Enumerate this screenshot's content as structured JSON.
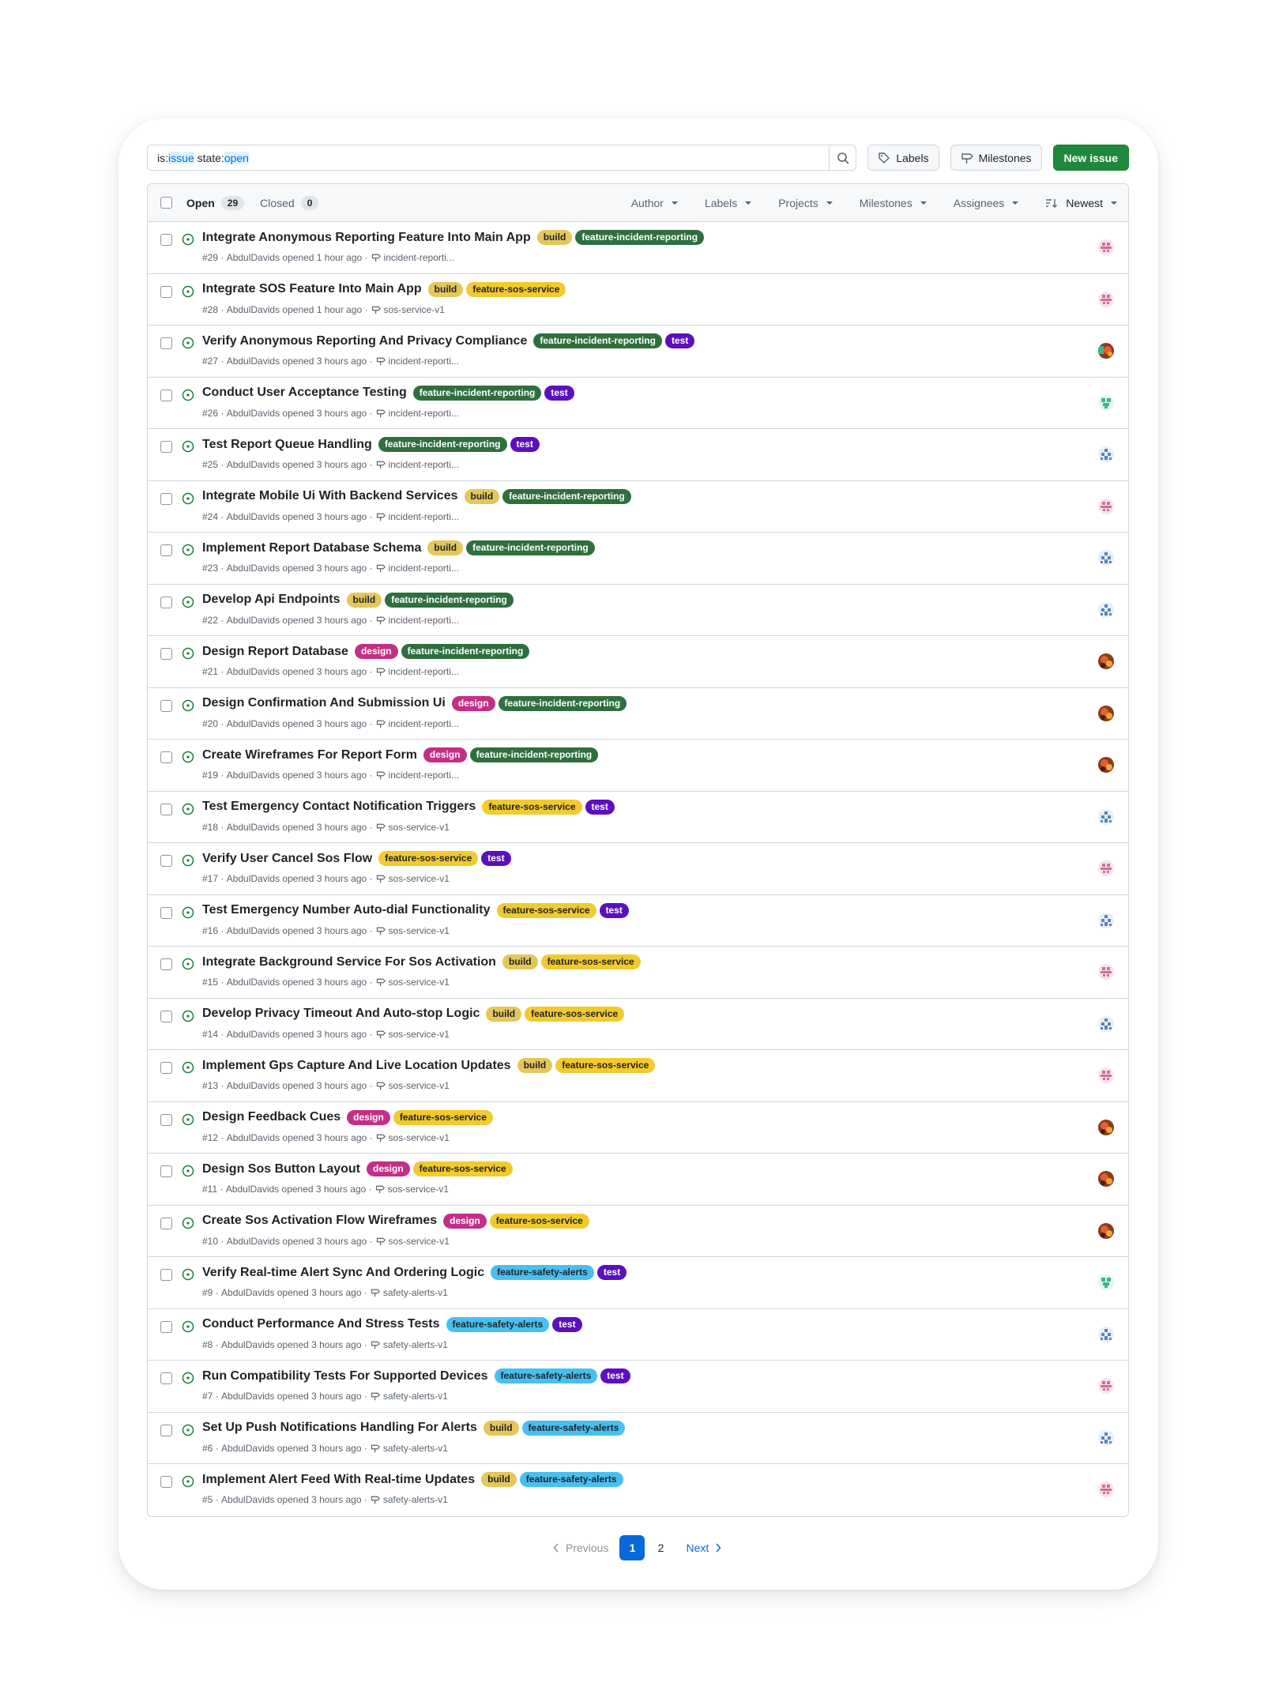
{
  "search": {
    "query_plain_1": "is:",
    "query_hl_1": "issue",
    "query_plain_2": " state:",
    "query_hl_2": "open"
  },
  "toolbar": {
    "labels": "Labels",
    "milestones": "Milestones",
    "new_issue": "New issue"
  },
  "header": {
    "open_label": "Open",
    "open_count": "29",
    "closed_label": "Closed",
    "closed_count": "0",
    "filters": {
      "author": "Author",
      "labels": "Labels",
      "projects": "Projects",
      "milestones": "Milestones",
      "assignees": "Assignees",
      "sort": "Newest"
    }
  },
  "colors": {
    "build": "#e4c65a",
    "feature-incident-reporting": "#2f6f3e",
    "feature-sos-service": "#f2ca2d",
    "test": "#5b0fbe",
    "design": "#c42f86",
    "feature-safety-alerts": "#47c0f0"
  },
  "issues": [
    {
      "title": "Integrate Anonymous Reporting Feature Into Main App",
      "labels": [
        "build",
        "feature-incident-reporting"
      ],
      "number": "#29",
      "author": "AbdulDavids",
      "time": "opened 1 hour ago",
      "milestone": "incident-reporti...",
      "avatar": "pink"
    },
    {
      "title": "Integrate SOS Feature Into Main App",
      "labels": [
        "build",
        "feature-sos-service"
      ],
      "number": "#28",
      "author": "AbdulDavids",
      "time": "opened 1 hour ago",
      "milestone": "sos-service-v1",
      "avatar": "pink"
    },
    {
      "title": "Verify Anonymous Reporting And Privacy Compliance",
      "labels": [
        "feature-incident-reporting",
        "test"
      ],
      "number": "#27",
      "author": "AbdulDavids",
      "time": "opened 3 hours ago",
      "milestone": "incident-reporti...",
      "avatar": "duo"
    },
    {
      "title": "Conduct User Acceptance Testing",
      "labels": [
        "feature-incident-reporting",
        "test"
      ],
      "number": "#26",
      "author": "AbdulDavids",
      "time": "opened 3 hours ago",
      "milestone": "incident-reporti...",
      "avatar": "green"
    },
    {
      "title": "Test Report Queue Handling",
      "labels": [
        "feature-incident-reporting",
        "test"
      ],
      "number": "#25",
      "author": "AbdulDavids",
      "time": "opened 3 hours ago",
      "milestone": "incident-reporti...",
      "avatar": "blue"
    },
    {
      "title": "Integrate Mobile Ui With Backend Services",
      "labels": [
        "build",
        "feature-incident-reporting"
      ],
      "number": "#24",
      "author": "AbdulDavids",
      "time": "opened 3 hours ago",
      "milestone": "incident-reporti...",
      "avatar": "pink"
    },
    {
      "title": "Implement Report Database Schema",
      "labels": [
        "build",
        "feature-incident-reporting"
      ],
      "number": "#23",
      "author": "AbdulDavids",
      "time": "opened 3 hours ago",
      "milestone": "incident-reporti...",
      "avatar": "blue"
    },
    {
      "title": "Develop Api Endpoints",
      "labels": [
        "build",
        "feature-incident-reporting"
      ],
      "number": "#22",
      "author": "AbdulDavids",
      "time": "opened 3 hours ago",
      "milestone": "incident-reporti...",
      "avatar": "blue"
    },
    {
      "title": "Design Report Database",
      "labels": [
        "design",
        "feature-incident-reporting"
      ],
      "number": "#21",
      "author": "AbdulDavids",
      "time": "opened 3 hours ago",
      "milestone": "incident-reporti...",
      "avatar": "photo"
    },
    {
      "title": "Design Confirmation And Submission Ui",
      "labels": [
        "design",
        "feature-incident-reporting"
      ],
      "number": "#20",
      "author": "AbdulDavids",
      "time": "opened 3 hours ago",
      "milestone": "incident-reporti...",
      "avatar": "photo"
    },
    {
      "title": "Create Wireframes For Report Form",
      "labels": [
        "design",
        "feature-incident-reporting"
      ],
      "number": "#19",
      "author": "AbdulDavids",
      "time": "opened 3 hours ago",
      "milestone": "incident-reporti...",
      "avatar": "photo"
    },
    {
      "title": "Test Emergency Contact Notification Triggers",
      "labels": [
        "feature-sos-service",
        "test"
      ],
      "number": "#18",
      "author": "AbdulDavids",
      "time": "opened 3 hours ago",
      "milestone": "sos-service-v1",
      "avatar": "blue"
    },
    {
      "title": "Verify User Cancel Sos Flow",
      "labels": [
        "feature-sos-service",
        "test"
      ],
      "number": "#17",
      "author": "AbdulDavids",
      "time": "opened 3 hours ago",
      "milestone": "sos-service-v1",
      "avatar": "pink"
    },
    {
      "title": "Test Emergency Number Auto-dial Functionality",
      "labels": [
        "feature-sos-service",
        "test"
      ],
      "number": "#16",
      "author": "AbdulDavids",
      "time": "opened 3 hours ago",
      "milestone": "sos-service-v1",
      "avatar": "blue"
    },
    {
      "title": "Integrate Background Service For Sos Activation",
      "labels": [
        "build",
        "feature-sos-service"
      ],
      "number": "#15",
      "author": "AbdulDavids",
      "time": "opened 3 hours ago",
      "milestone": "sos-service-v1",
      "avatar": "pink"
    },
    {
      "title": "Develop Privacy Timeout And Auto-stop Logic",
      "labels": [
        "build",
        "feature-sos-service"
      ],
      "number": "#14",
      "author": "AbdulDavids",
      "time": "opened 3 hours ago",
      "milestone": "sos-service-v1",
      "avatar": "blue"
    },
    {
      "title": "Implement Gps Capture And Live Location Updates",
      "labels": [
        "build",
        "feature-sos-service"
      ],
      "number": "#13",
      "author": "AbdulDavids",
      "time": "opened 3 hours ago",
      "milestone": "sos-service-v1",
      "avatar": "pink"
    },
    {
      "title": "Design Feedback Cues",
      "labels": [
        "design",
        "feature-sos-service"
      ],
      "number": "#12",
      "author": "AbdulDavids",
      "time": "opened 3 hours ago",
      "milestone": "sos-service-v1",
      "avatar": "photo"
    },
    {
      "title": "Design Sos Button Layout",
      "labels": [
        "design",
        "feature-sos-service"
      ],
      "number": "#11",
      "author": "AbdulDavids",
      "time": "opened 3 hours ago",
      "milestone": "sos-service-v1",
      "avatar": "photo"
    },
    {
      "title": "Create Sos Activation Flow Wireframes",
      "labels": [
        "design",
        "feature-sos-service"
      ],
      "number": "#10",
      "author": "AbdulDavids",
      "time": "opened 3 hours ago",
      "milestone": "sos-service-v1",
      "avatar": "photo"
    },
    {
      "title": "Verify Real-time Alert Sync And Ordering Logic",
      "labels": [
        "feature-safety-alerts",
        "test"
      ],
      "number": "#9",
      "author": "AbdulDavids",
      "time": "opened 3 hours ago",
      "milestone": "safety-alerts-v1",
      "avatar": "green"
    },
    {
      "title": "Conduct Performance And Stress Tests",
      "labels": [
        "feature-safety-alerts",
        "test"
      ],
      "number": "#8",
      "author": "AbdulDavids",
      "time": "opened 3 hours ago",
      "milestone": "safety-alerts-v1",
      "avatar": "blue"
    },
    {
      "title": "Run Compatibility Tests For Supported Devices",
      "labels": [
        "feature-safety-alerts",
        "test"
      ],
      "number": "#7",
      "author": "AbdulDavids",
      "time": "opened 3 hours ago",
      "milestone": "safety-alerts-v1",
      "avatar": "pink"
    },
    {
      "title": "Set Up Push Notifications Handling For Alerts",
      "labels": [
        "build",
        "feature-safety-alerts"
      ],
      "number": "#6",
      "author": "AbdulDavids",
      "time": "opened 3 hours ago",
      "milestone": "safety-alerts-v1",
      "avatar": "blue"
    },
    {
      "title": "Implement Alert Feed With Real-time Updates",
      "labels": [
        "build",
        "feature-safety-alerts"
      ],
      "number": "#5",
      "author": "AbdulDavids",
      "time": "opened 3 hours ago",
      "milestone": "safety-alerts-v1",
      "avatar": "pink"
    }
  ],
  "pagination": {
    "previous": "Previous",
    "pages": [
      "1",
      "2"
    ],
    "current": "1",
    "next": "Next"
  }
}
